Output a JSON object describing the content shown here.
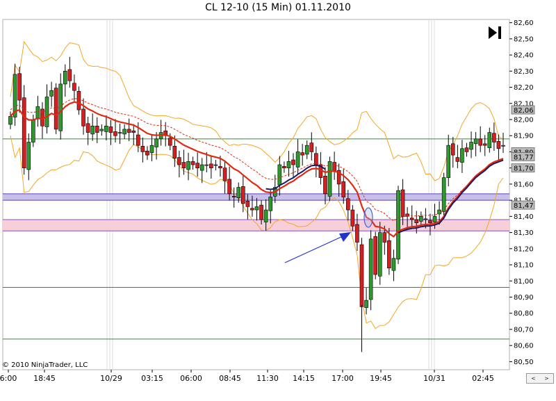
{
  "title": "CL 12-10 (15 Min)  01.11.2010",
  "copyright": "© 2010 NinjaTrader, LLC",
  "nav": {
    "left": "<",
    "right": ">"
  },
  "chart_data": {
    "type": "candlestick",
    "y_ticks": [
      "82,60",
      "82,50",
      "82,40",
      "82,30",
      "82,20",
      "82,10",
      "82,00",
      "81,90",
      "81,80",
      "81,70",
      "81,60",
      "81,50",
      "81,40",
      "81,30",
      "81,20",
      "81,10",
      "81,00",
      "80,90",
      "80,80",
      "80,70",
      "80,60",
      "80,50"
    ],
    "ylim": [
      80.45,
      82.62
    ],
    "x_ticks": [
      "6:00",
      "18:45",
      "10/29",
      "03:15",
      "06:00",
      "08:45",
      "11:30",
      "14:15",
      "17:00",
      "19:45",
      "10/31",
      "02:45"
    ],
    "price_labels": [
      {
        "text": "82,06",
        "value": 82.06,
        "color": "#bbbbbb"
      },
      {
        "text": "81,80",
        "value": 81.8,
        "color": "#bbbbbb"
      },
      {
        "text": "81,77",
        "value": 81.77,
        "color": "#bbbbbb"
      },
      {
        "text": "81,70",
        "value": 81.7,
        "color": "#bbbbbb"
      },
      {
        "text": "81,47",
        "value": 81.47,
        "color": "#bbbbbb"
      }
    ],
    "horizontal_lines": [
      {
        "value": 81.88,
        "color": "#2f8f2f"
      },
      {
        "value": 80.96,
        "color": "#2f8f2f"
      },
      {
        "value": 80.64,
        "color": "#2f8f2f"
      }
    ],
    "zones": [
      {
        "from": 81.5,
        "to": 81.54,
        "color": "#c9c0ea",
        "edge": "#5a3fbf"
      },
      {
        "from": 81.31,
        "to": 81.38,
        "color": "#f6cfd8",
        "edge": "#8a4fd0"
      }
    ],
    "candles_close": [
      82.02,
      82.28,
      82.12,
      81.7,
      81.86,
      82.0,
      82.08,
      81.96,
      82.14,
      82.18,
      81.94,
      82.22,
      82.3,
      82.24,
      82.18,
      82.06,
      81.96,
      81.92,
      81.96,
      81.92,
      81.94,
      81.96,
      81.92,
      81.9,
      81.92,
      81.94,
      81.92,
      81.92,
      81.84,
      81.8,
      81.78,
      81.84,
      81.88,
      81.92,
      81.9,
      81.84,
      81.76,
      81.72,
      81.7,
      81.74,
      81.72,
      81.7,
      81.72,
      81.72,
      81.7,
      81.72,
      81.7,
      81.62,
      81.54,
      81.52,
      81.58,
      81.48,
      81.46,
      81.44,
      81.46,
      81.38,
      81.44,
      81.52,
      81.58,
      81.72,
      81.7,
      81.74,
      81.72,
      81.8,
      81.78,
      81.84,
      81.8,
      81.72,
      81.64,
      81.54,
      81.74,
      81.68,
      81.6,
      81.52,
      81.44,
      81.34,
      81.24,
      80.84,
      80.88,
      81.26,
      81.04,
      81.3,
      81.24,
      81.08,
      81.14,
      81.56,
      81.4,
      81.4,
      81.38,
      81.36,
      81.4,
      81.38,
      81.36,
      81.4,
      81.44,
      81.64,
      81.84,
      81.78,
      81.74,
      81.82,
      81.8,
      81.86,
      81.88,
      81.84,
      81.84,
      81.92,
      81.86,
      81.82,
      81.84
    ],
    "series": [
      {
        "name": "",
        "kind": "ema",
        "color": "#e02a10"
      },
      {
        "name": "",
        "kind": "envelope",
        "color": "#f5a623"
      },
      {
        "name": "",
        "kind": "average",
        "color": "#1a1a66"
      }
    ],
    "annotations": [
      {
        "kind": "arrow",
        "color": "#2233cc"
      },
      {
        "kind": "ellipse",
        "color": "#4a5fd8"
      }
    ]
  }
}
